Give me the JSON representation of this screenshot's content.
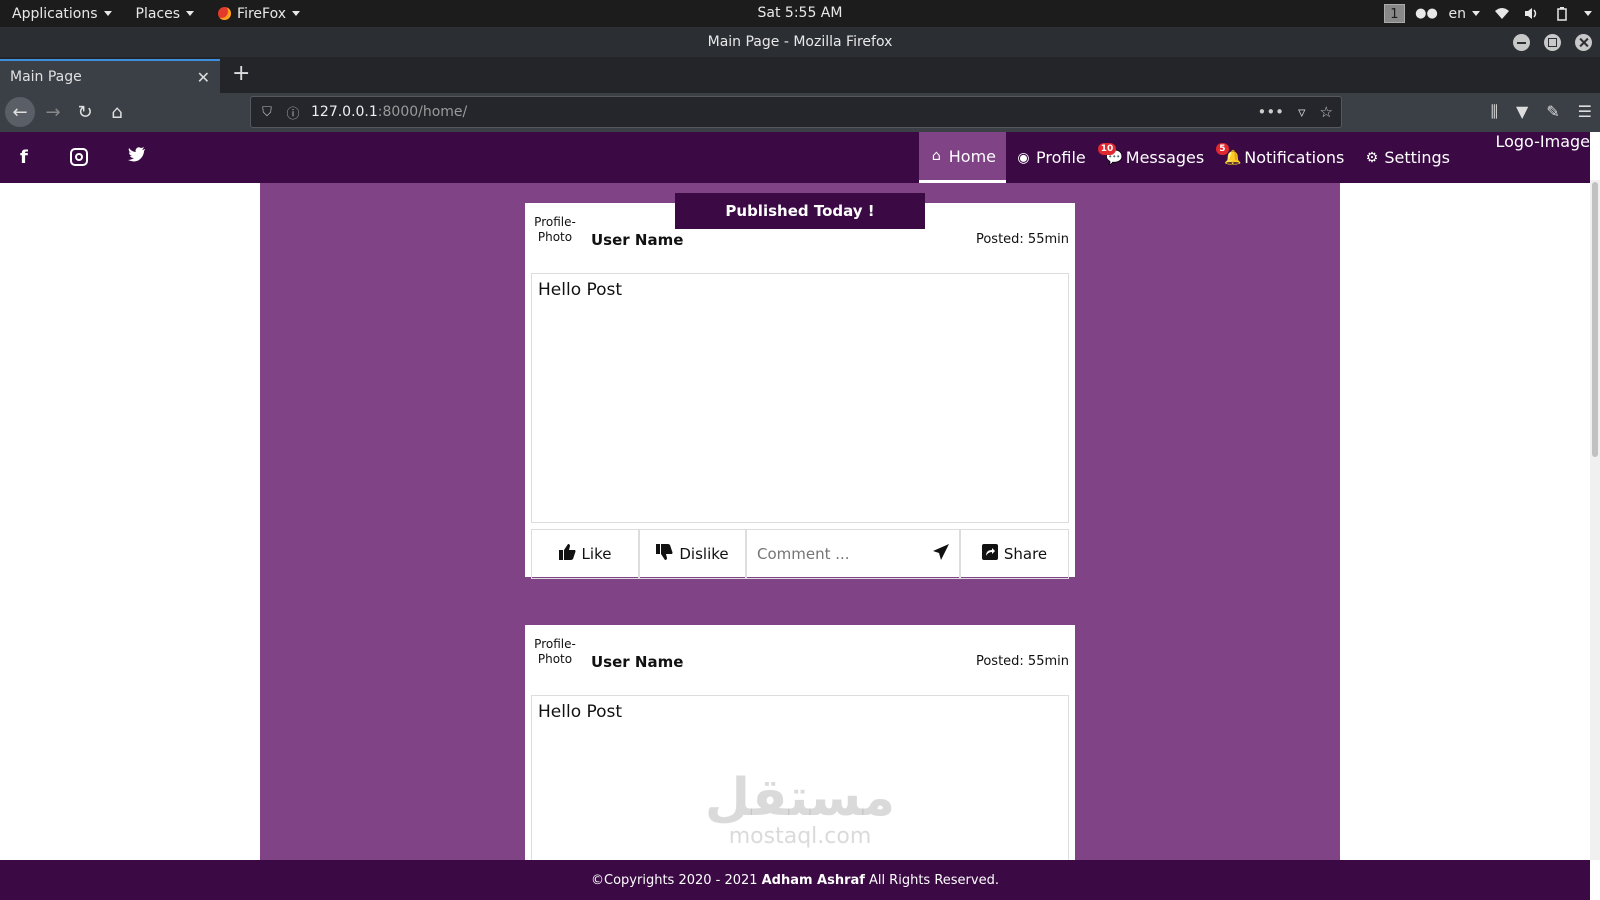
{
  "topbar": {
    "applications": "Applications",
    "places": "Places",
    "browser_menu": "FireFox",
    "clock": "Sat  5:55 AM",
    "workspace": "1",
    "language": "en"
  },
  "window": {
    "title": "Main Page - Mozilla Firefox"
  },
  "tabs": [
    {
      "label": "Main Page"
    }
  ],
  "url": {
    "host": "127.0.0.1",
    "path": ":8000/home/"
  },
  "site": {
    "menu": [
      {
        "label": "Home",
        "icon": "home-icon",
        "active": true
      },
      {
        "label": "Profile",
        "icon": "user-circle-icon"
      },
      {
        "label": "Messages",
        "icon": "comments-icon",
        "badge": "10"
      },
      {
        "label": "Notifications",
        "icon": "bell-icon",
        "badge": "5"
      },
      {
        "label": "Settings",
        "icon": "gear-icon"
      }
    ],
    "logo": "Logo-Image",
    "accent": "#3b0a45",
    "background": "#7f4386"
  },
  "posts": [
    {
      "banner": "Published Today !",
      "photo": "Profile-Photo",
      "user": "User Name",
      "posted": "Posted: 55min",
      "body": "Hello Post",
      "like": "Like",
      "dislike": "Dislike",
      "comment_placeholder": "Comment ...",
      "share": "Share"
    },
    {
      "photo": "Profile-Photo",
      "user": "User Name",
      "posted": "Posted: 55min",
      "body": "Hello Post"
    }
  ],
  "watermark": {
    "arabic": "مستقل",
    "latin": "mostaql.com"
  },
  "footer": {
    "prefix": "©Copyrights 2020 - 2021",
    "author": "Adham Ashraf",
    "suffix": "All Rights Reserved."
  }
}
